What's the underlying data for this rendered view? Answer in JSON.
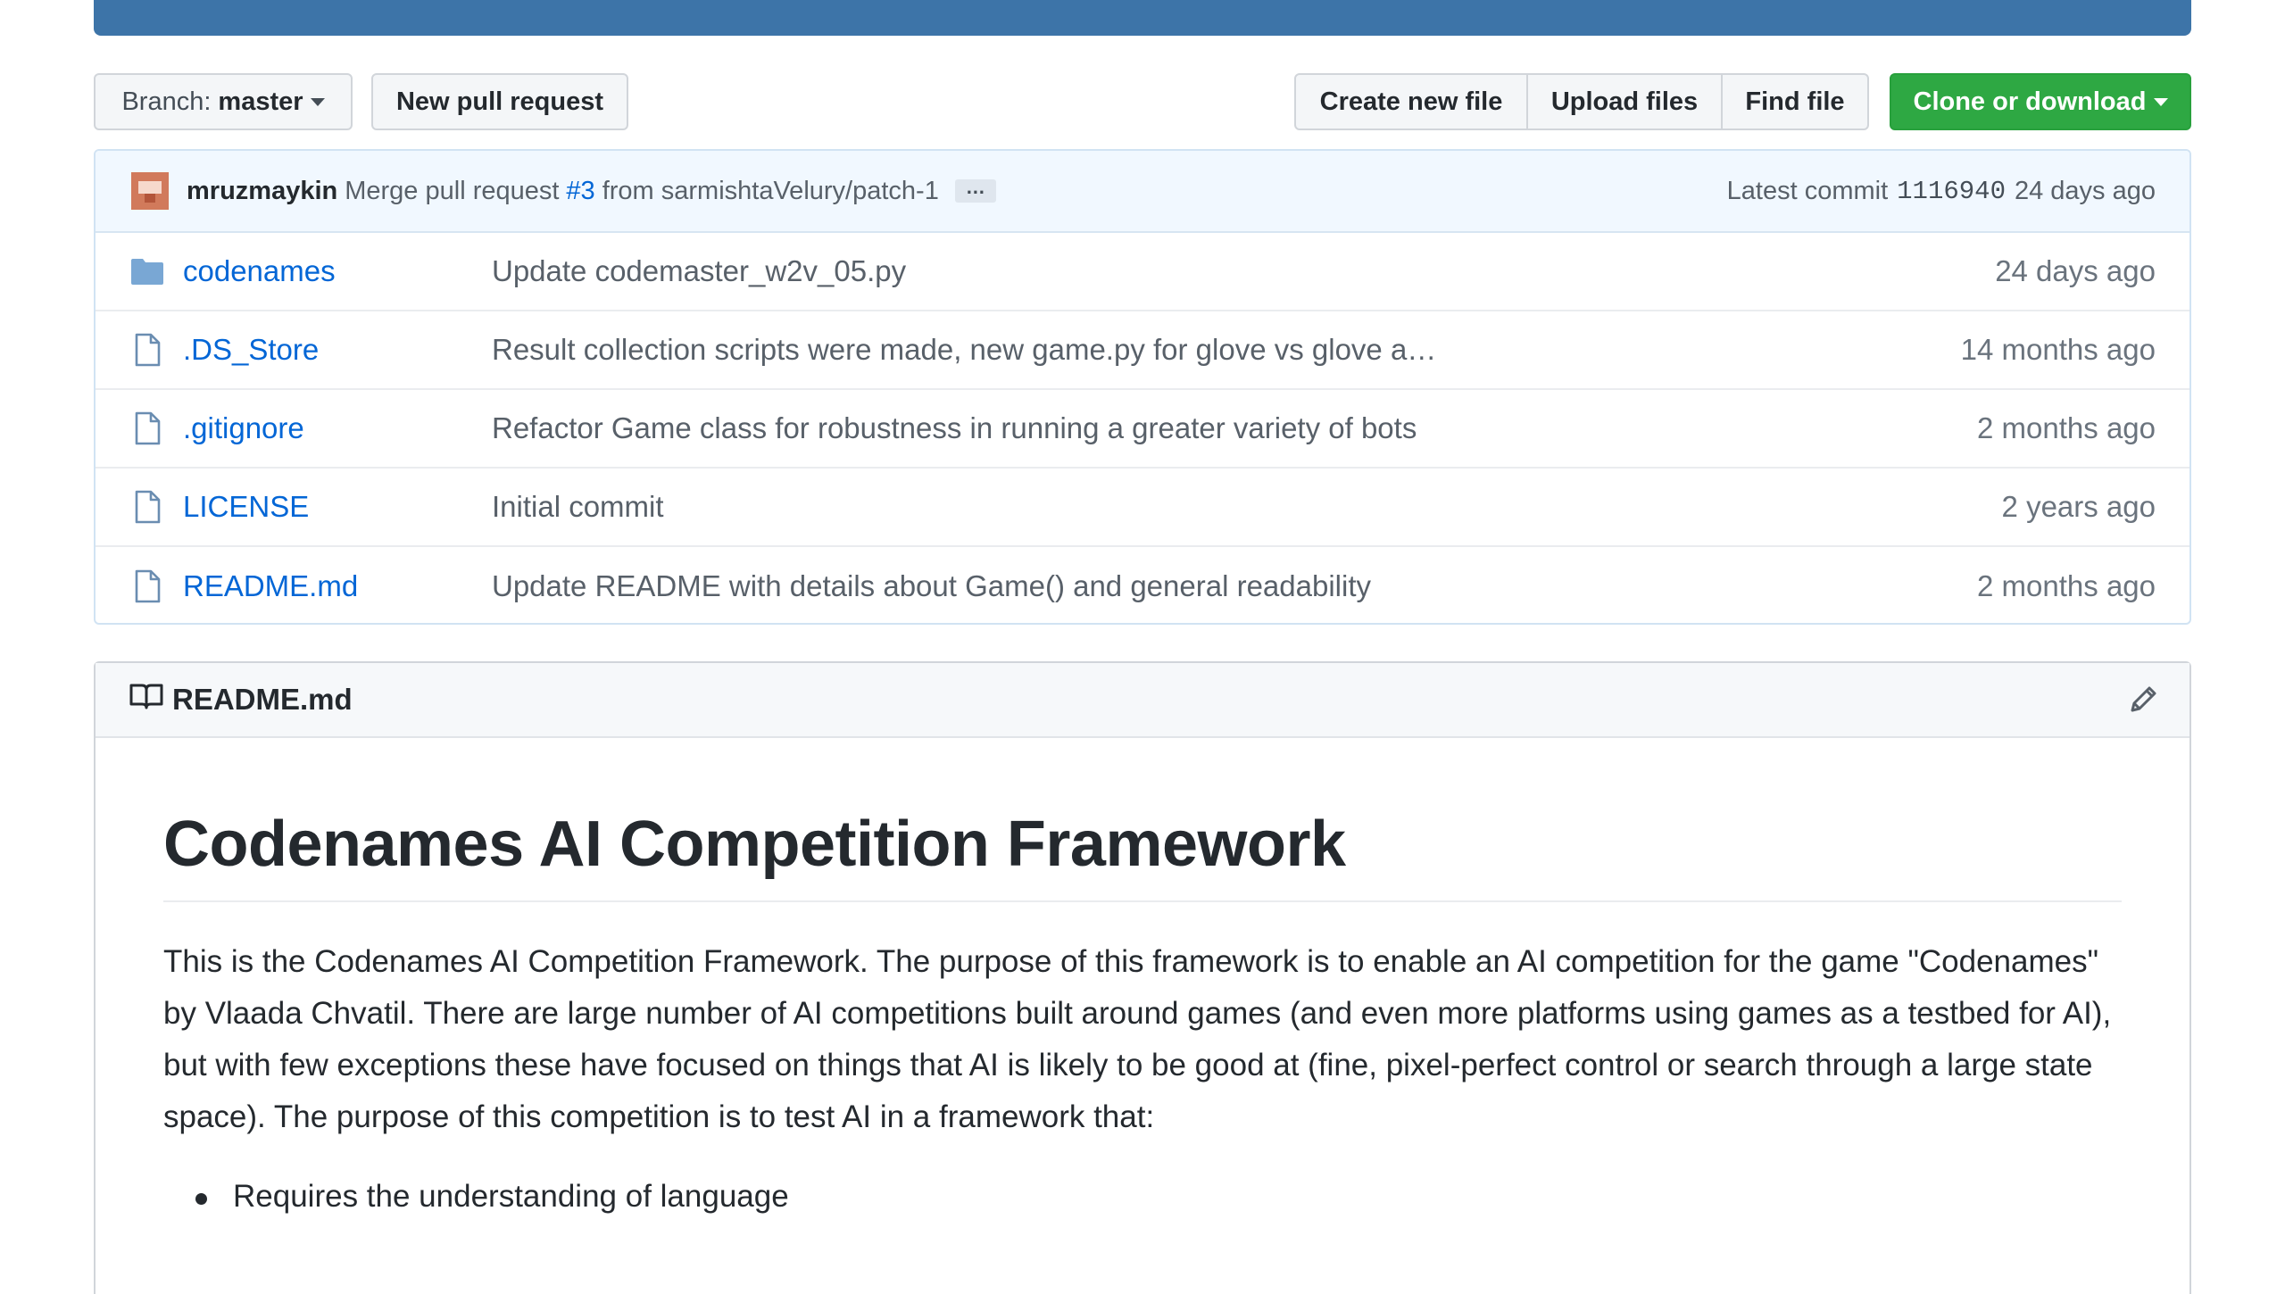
{
  "toolbar": {
    "branch_prefix": "Branch:",
    "branch_name": "master",
    "new_pull_request": "New pull request",
    "create_new_file": "Create new file",
    "upload_files": "Upload files",
    "find_file": "Find file",
    "clone_or_download": "Clone or download"
  },
  "commit": {
    "author": "mruzmaykin",
    "message_prefix": "Merge pull request",
    "pr_link": "#3",
    "message_suffix": "from sarmishtaVelury/patch-1",
    "ellipsis": "…",
    "latest_label": "Latest commit",
    "sha": "1116940",
    "age": "24 days ago"
  },
  "files": [
    {
      "type": "folder",
      "name": "codenames",
      "message": "Update codemaster_w2v_05.py",
      "age": "24 days ago"
    },
    {
      "type": "file",
      "name": ".DS_Store",
      "message": "Result collection scripts were made, new game.py for glove vs glove a…",
      "age": "14 months ago"
    },
    {
      "type": "file",
      "name": ".gitignore",
      "message": "Refactor Game class for robustness in running a greater variety of bots",
      "age": "2 months ago"
    },
    {
      "type": "file",
      "name": "LICENSE",
      "message": "Initial commit",
      "age": "2 years ago"
    },
    {
      "type": "file",
      "name": "README.md",
      "message": "Update README with details about Game() and general readability",
      "age": "2 months ago"
    }
  ],
  "readme": {
    "header_title": "README.md",
    "heading": "Codenames AI Competition Framework",
    "paragraph": "This is the Codenames AI Competition Framework. The purpose of this framework is to enable an AI competition for the game \"Codenames\" by Vlaada Chvatil. There are large number of AI competitions built around games (and even more platforms using games as a testbed for AI), but with few exceptions these have focused on things that AI is likely to be good at (fine, pixel-perfect control or search through a large state space). The purpose of this competition is to test AI in a framework that:",
    "bullets": [
      "Requires the understanding of language"
    ]
  },
  "colors": {
    "link": "#0366d6",
    "clone_button": "#2ea843",
    "commit_bar": "#f1f8ff",
    "top_bar": "#3d74a8"
  }
}
